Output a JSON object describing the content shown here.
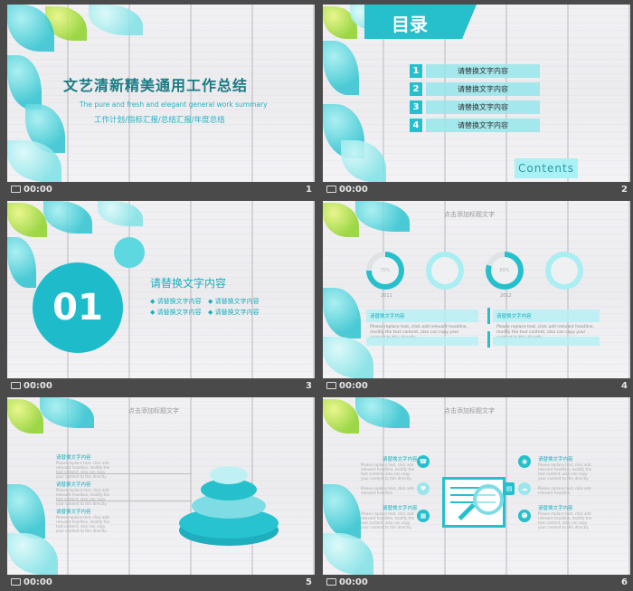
{
  "slides": [
    {
      "number": "1",
      "time": "00:00",
      "title": "文艺清新精美通用工作总结",
      "subtitle_en": "The pure and fresh and elegant general work summary",
      "subtitle_cn": "工作计划/指标汇报/总结汇报/年度总结"
    },
    {
      "number": "2",
      "time": "00:00",
      "heading": "目录",
      "items": [
        {
          "num": "1",
          "label": "请替换文字内容"
        },
        {
          "num": "2",
          "label": "请替换文字内容"
        },
        {
          "num": "3",
          "label": "请替换文字内容"
        },
        {
          "num": "4",
          "label": "请替换文字内容"
        }
      ],
      "contents_label": "Contents"
    },
    {
      "number": "3",
      "time": "00:00",
      "section_num": "01",
      "title": "请替换文字内容",
      "bullets": [
        "请替换文字内容",
        "请替换文字内容",
        "请替换文字内容",
        "请替换文字内容"
      ]
    },
    {
      "number": "4",
      "time": "00:00",
      "ghost_title": "点击添加标题文字",
      "rings": [
        {
          "label": "75%",
          "year": "2011",
          "progress": 0.75
        },
        {
          "label": "",
          "year": "",
          "progress": 1.0
        },
        {
          "label": "80%",
          "year": "2012",
          "progress": 0.8
        },
        {
          "label": "",
          "year": "",
          "progress": 1.0
        }
      ],
      "panels": [
        {
          "heading": "请替换文字内容",
          "body": "Please replace text, click add relevant headline, modify the text content, also can copy your content to this directly."
        },
        {
          "heading": "请替换文字内容",
          "body": "Please replace text, click add relevant headline, modify the text content, also can copy your content to this directly."
        }
      ]
    },
    {
      "number": "5",
      "time": "00:00",
      "ghost_title": "点击添加标题文字",
      "entries": [
        {
          "heading": "请替换文字内容",
          "body": "Please replace text, click add relevant headline, modify the text content, also can copy your content to this directly."
        },
        {
          "heading": "请替换文字内容",
          "body": "Please replace text, click add relevant headline, modify the text content, also can copy your content to this directly."
        },
        {
          "heading": "请替换文字内容",
          "body": "Please replace text, click add relevant headline, modify the text content, also can copy your content to this directly."
        }
      ]
    },
    {
      "number": "6",
      "time": "00:00",
      "ghost_title": "点击添加标题文字",
      "left": [
        {
          "heading": "请替换文字内容",
          "body": "Please replace text, click add relevant headline, modify the text content, also can copy your content to this directly.",
          "icon": "phone-icon"
        },
        {
          "heading": "请替换文字内容",
          "body": "Please replace text, click add relevant headline.",
          "icon": "heart-icon"
        },
        {
          "heading": "请替换文字内容",
          "body": "Please replace text, click add relevant headline, modify the text content, also can copy your content to this directly.",
          "icon": "calendar-icon"
        }
      ],
      "right": [
        {
          "heading": "请替换文字内容",
          "body": "Please replace text, click add relevant headline, modify the text content, also can copy your content to this directly.",
          "icon": "location-icon"
        },
        {
          "heading": "请替换文字内容",
          "body": "Please replace text, click add relevant headline.",
          "icon": "cloud-icon"
        },
        {
          "heading": "请替换文字内容",
          "body": "Please replace text, click add relevant headline, modify the text content, also can copy your content to this directly.",
          "icon": "user-icon"
        }
      ]
    }
  ],
  "colors": {
    "accent": "#25c0cc",
    "title": "#1a7b83",
    "background": "#4a4a4a"
  }
}
